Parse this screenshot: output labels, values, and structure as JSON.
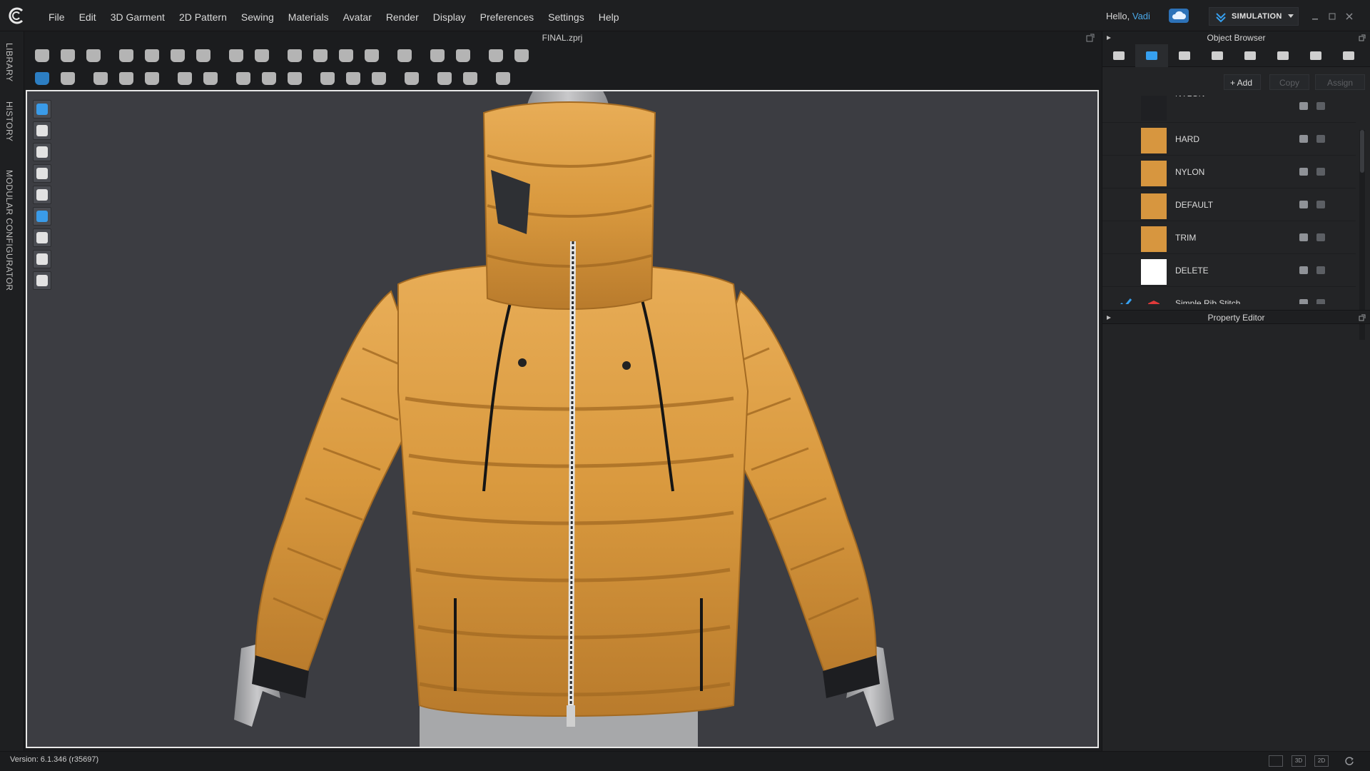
{
  "app": {
    "menu": [
      "File",
      "Edit",
      "3D Garment",
      "2D Pattern",
      "Sewing",
      "Materials",
      "Avatar",
      "Render",
      "Display",
      "Preferences",
      "Settings",
      "Help"
    ],
    "greeting_prefix": "Hello,",
    "user_name": "Vadi",
    "mode": "SIMULATION",
    "document_title": "FINAL.zprj"
  },
  "left_tabs": [
    "LIBRARY",
    "HISTORY",
    "MODULAR CONFIGURATOR"
  ],
  "object_browser": {
    "title": "Object Browser",
    "buttons": {
      "add": "+ Add",
      "copy": "Copy",
      "assign": "Assign"
    },
    "materials": [
      {
        "name": "NYLON",
        "color": "#1f2023",
        "checked": false,
        "kind": "fabric",
        "partial": true
      },
      {
        "name": "HARD",
        "color": "#d7963f",
        "checked": false,
        "kind": "fabric"
      },
      {
        "name": "NYLON",
        "color": "#d7963f",
        "checked": false,
        "kind": "fabric"
      },
      {
        "name": "DEFAULT",
        "color": "#d7963f",
        "checked": false,
        "kind": "fabric"
      },
      {
        "name": "TRIM",
        "color": "#d7963f",
        "checked": false,
        "kind": "fabric"
      },
      {
        "name": "DELETE",
        "color": "#ffffff",
        "checked": false,
        "kind": "fabric"
      },
      {
        "name": "Simple Rib Stitch",
        "color": "#e03a3a",
        "checked": true,
        "kind": "substance"
      }
    ]
  },
  "property_editor": {
    "title": "Property Editor"
  },
  "status": {
    "version": "Version: 6.1.346 (r35697)",
    "view_3d": "3D",
    "view_2d": "2D"
  },
  "colors": {
    "accent": "#36a0f0",
    "garment": "#d9993e",
    "viewport_bg": "#3c3d42"
  }
}
